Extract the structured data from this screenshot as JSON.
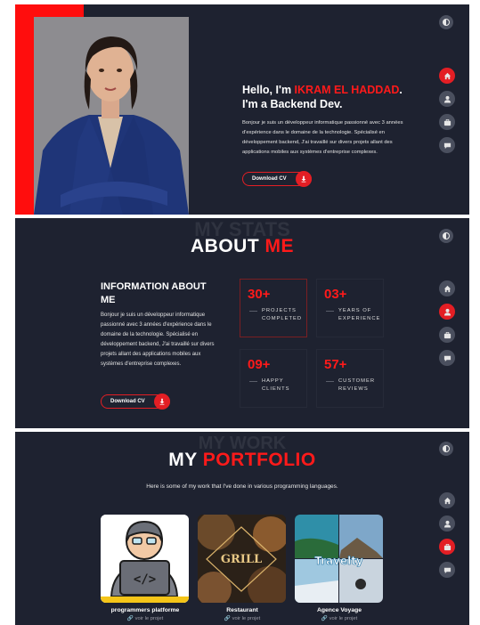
{
  "hero": {
    "greeting_prefix": "Hello, I'm ",
    "name": "IKRAM EL HADDAD",
    "greeting_suffix": ".",
    "role": "I'm a Backend Dev.",
    "bio": "Bonjour je suis un développeur informatique passionné avec 3 années d'expérience dans le domaine de la technologie. Spécialisé en développement backend, J'ai travaillé sur divers projets allant des applications mobiles aux systèmes d'entreprise complexes.",
    "cv_label": "Download CV"
  },
  "about": {
    "ghost_text": "MY STATS",
    "title_white": "ABOUT ",
    "title_red": "ME",
    "info_heading": "INFORMATION ABOUT ME",
    "info_text": "Bonjour je suis un développeur informatique passionné avec 3 années d'expérience dans le domaine de la technologie. Spécialisé en développement backend, J'ai travaillé sur divers projets allant des applications mobiles aux systèmes d'entreprise complexes.",
    "cv_label": "Download CV",
    "stats": [
      {
        "number": "30+",
        "line1": "PROJECTS",
        "line2": "COMPLETED"
      },
      {
        "number": "03+",
        "line1": "YEARS OF",
        "line2": "EXPERIENCE"
      },
      {
        "number": "09+",
        "line1": "HAPPY",
        "line2": "CLIENTS"
      },
      {
        "number": "57+",
        "line1": "CUSTOMER",
        "line2": "REVIEWS"
      }
    ]
  },
  "portfolio": {
    "ghost_text": "MY WORK",
    "title_white": "MY ",
    "title_red": "PORTFOLIO",
    "subtitle": "Here is some of my work that I've done in various programming languages.",
    "projects": [
      {
        "title": "programmers platforme",
        "link": "voir le projet"
      },
      {
        "title": "Restaurant",
        "link": "voir le projet",
        "image_text": "GRILL"
      },
      {
        "title": "Agence Voyage",
        "link": "voir le projet",
        "image_text": "Travelty"
      }
    ]
  },
  "nav": {
    "items": [
      "home-icon",
      "user-icon",
      "briefcase-icon",
      "chat-icon"
    ],
    "theme_icon": "contrast-icon"
  },
  "colors": {
    "accent": "#e31e24",
    "panel": "#1e2230",
    "hero_red": "#ff0d0d"
  }
}
